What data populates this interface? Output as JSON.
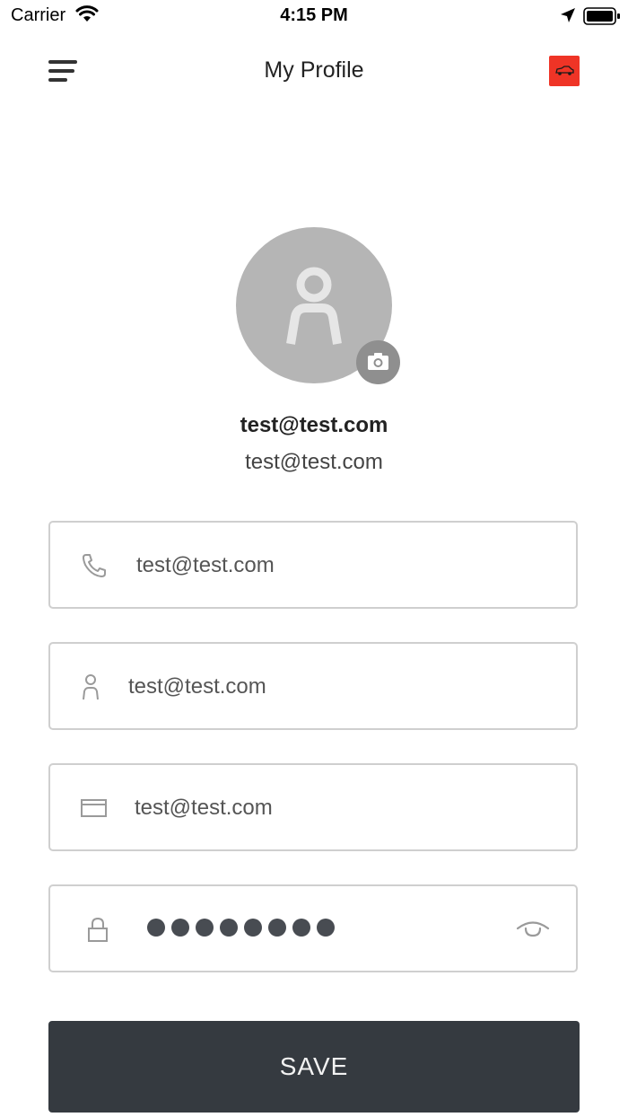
{
  "status_bar": {
    "carrier": "Carrier",
    "time": "4:15 PM"
  },
  "header": {
    "title": "My Profile",
    "menu_icon": "hamburger-menu-icon",
    "logo_icon": "car-logo-icon",
    "logo_color": "#ef3426"
  },
  "profile": {
    "name": "test@test.com",
    "email": "test@test.com",
    "avatar_icon": "person-icon",
    "camera_icon": "camera-icon"
  },
  "form": {
    "phone": {
      "value": "test@test.com",
      "icon": "phone-icon"
    },
    "name": {
      "value": "test@test.com",
      "icon": "person-icon"
    },
    "email": {
      "value": "test@test.com",
      "icon": "envelope-icon"
    },
    "password": {
      "masked_length": 8,
      "icon": "lock-icon",
      "toggle_icon": "eye-icon"
    }
  },
  "save_button": {
    "label": "SAVE"
  },
  "colors": {
    "save_button_bg": "#353a40",
    "avatar_bg": "#b5b5b5",
    "field_border": "#cfcfcf"
  }
}
